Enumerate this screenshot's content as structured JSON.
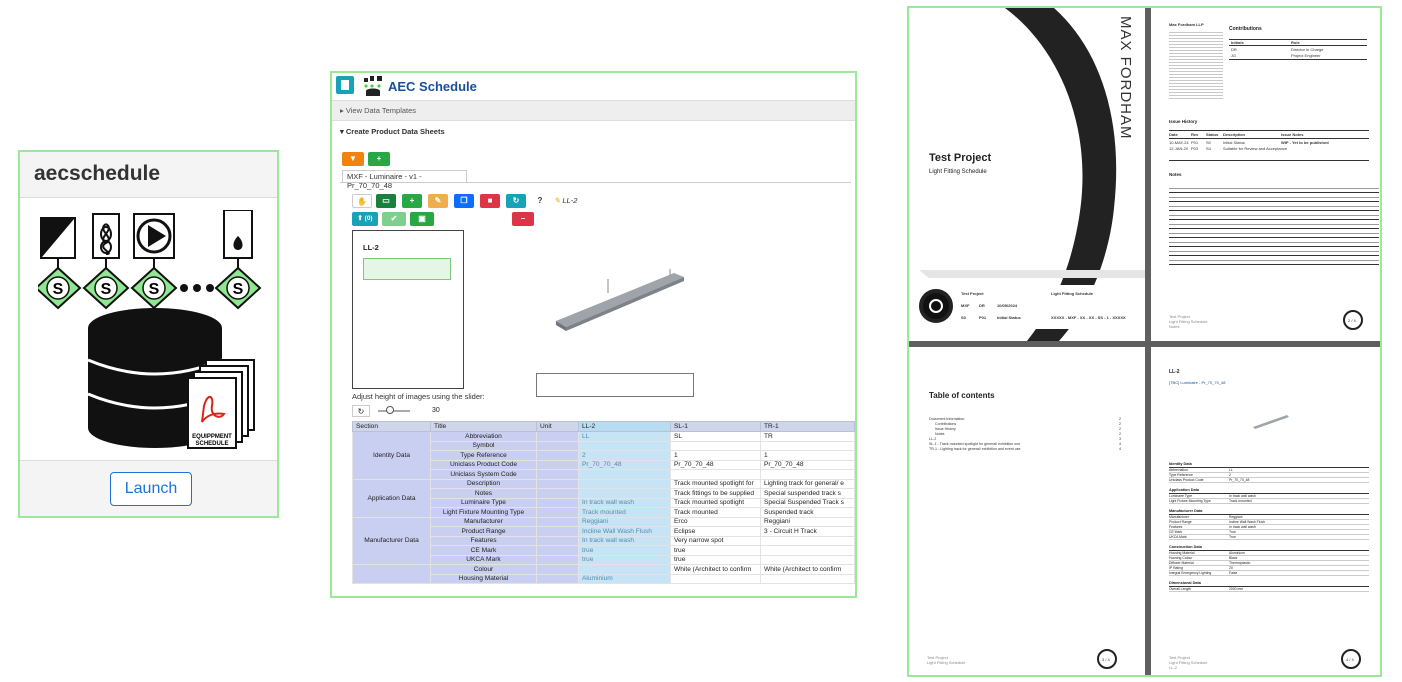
{
  "card_aec": {
    "title": "aecschedule",
    "launch_label": "Launch",
    "logo_letter": "S",
    "logo_badge_line1": "EQUIPPMENT",
    "logo_badge_line2": "SCHEDULE"
  },
  "app": {
    "title": "AEC Schedule",
    "view_templates": "View Data Templates",
    "create_sheets": "Create Product Data Sheets",
    "tab_label": "MXF - Luminaire - v1 - Pr_70_70_48",
    "toolbar_help": "?",
    "current_item": "LL-2",
    "upload_label": "(0)",
    "pds_label": "LL-2",
    "slider_hint": "Adjust height of images using the slider:",
    "slider_value": "30",
    "table": {
      "headers": [
        "Section",
        "Title",
        "Unit",
        "LL-2",
        "SL-1",
        "TR-1"
      ],
      "groups": [
        {
          "section": "Identity Data",
          "rows": [
            {
              "title": "Abbreviation",
              "unit": "",
              "ll2": "LL",
              "sl1": "SL",
              "tr1": "TR"
            },
            {
              "title": "Symbol",
              "unit": "",
              "ll2": "",
              "sl1": "",
              "tr1": ""
            },
            {
              "title": "Type Reference",
              "unit": "",
              "ll2": "2",
              "sl1": "1",
              "tr1": "1"
            },
            {
              "title": "Uniclass Product Code",
              "unit": "",
              "ll2": "Pr_70_70_48",
              "sl1": "Pr_70_70_48",
              "tr1": "Pr_70_70_48"
            },
            {
              "title": "Uniclass System Code",
              "unit": "",
              "ll2": "",
              "sl1": "",
              "tr1": ""
            }
          ]
        },
        {
          "section": "Application Data",
          "rows": [
            {
              "title": "Description",
              "unit": "",
              "ll2": "",
              "sl1": "Track mounted spotlight for",
              "tr1": "Lighting track for general/ e"
            },
            {
              "title": "Notes",
              "unit": "",
              "ll2": "",
              "sl1": "Track fittings to be supplied",
              "tr1": "Special suspended track s"
            },
            {
              "title": "Luminaire Type",
              "unit": "",
              "ll2": "In track wall wash",
              "sl1": "Track mounted spotlight",
              "tr1": "Special Suspended Track s"
            },
            {
              "title": "Light Fixture Mounting Type",
              "unit": "",
              "ll2": "Track mounted",
              "sl1": "Track mounted",
              "tr1": "Suspended track"
            }
          ]
        },
        {
          "section": "Manufacturer Data",
          "rows": [
            {
              "title": "Manufacturer",
              "unit": "",
              "ll2": "Reggiani",
              "sl1": "Erco",
              "tr1": "Reggiani"
            },
            {
              "title": "Product Range",
              "unit": "",
              "ll2": "Incline Wall Wash Flush",
              "sl1": "Eclipse",
              "tr1": "3 - Circuit H Track"
            },
            {
              "title": "Features",
              "unit": "",
              "ll2": "In track wall wash",
              "sl1": "Very narrow spot",
              "tr1": ""
            },
            {
              "title": "CE Mark",
              "unit": "",
              "ll2": "true",
              "sl1": "true",
              "tr1": ""
            },
            {
              "title": "UKCA Mark",
              "unit": "",
              "ll2": "true",
              "sl1": "true",
              "tr1": ""
            }
          ]
        },
        {
          "section": "",
          "rows": [
            {
              "title": "Colour",
              "unit": "",
              "ll2": "",
              "sl1": "White (Architect to confirm",
              "tr1": "White (Architect to confirm"
            },
            {
              "title": "Housing Material",
              "unit": "",
              "ll2": "Aluminium",
              "sl1": "",
              "tr1": ""
            }
          ]
        }
      ]
    }
  },
  "pdf": {
    "brand": "MAX FORDHAM",
    "project": "Test Project",
    "subtitle": "Light Fitting Schedule",
    "cover_meta": [
      "Test Project",
      "Light Fitting Schedule",
      "MXF",
      "DR",
      "10/05/2024",
      "S0",
      "P01",
      "Initial Status",
      "XXXXX - MXF - XX - XX - SS - 1 - XXXXX"
    ],
    "p2_company": "Max Fordham LLP",
    "p2_contrib_title": "Contributions",
    "p2_contrib_headers": [
      "Initials",
      "Role"
    ],
    "p2_contrib_rows": [
      [
        "DR",
        "Director in Charge"
      ],
      [
        "JG",
        "Project Engineer"
      ]
    ],
    "p2_issue_title": "Issue History",
    "p2_issue_headers": [
      "Date",
      "Rev",
      "Status",
      "Description",
      "Issue Notes"
    ],
    "p2_issue_rows": [
      [
        "10-MAY-24",
        "P01",
        "S0",
        "Initial Status",
        "WIP - Yet to be published"
      ],
      [
        "12-JAN-20",
        "P03",
        "S4",
        "Suitable for Review and Acceptance",
        ""
      ]
    ],
    "p2_notes_title": "Notes",
    "p2_footer": "Test Project",
    "p2_footer2": "Light Fitting Schedule",
    "p2_footer3": "Notes",
    "p2_page": "2 / 4",
    "toc_title": "Table of contents",
    "toc_items": [
      "Document Information",
      "Contributions",
      "Issue History",
      "Notes",
      "LL-2",
      "SL-1 - Track mounted spotlight for general/ exhibition use",
      "TR-1 - Lighting track for general/ exhibition and event use"
    ],
    "toc_pages": [
      "2",
      "2",
      "2",
      "2",
      "3",
      "4",
      "4"
    ],
    "p3_page": "3 / 4",
    "p4_title": "LL-2",
    "p4_sub": "[TBC] Luminaire - Pr_70_70_48",
    "p4_sections": [
      {
        "name": "Identity Data",
        "rows": [
          [
            "Abbreviation",
            "LL"
          ],
          [
            "Type Reference",
            "2"
          ],
          [
            "Uniclass Product Code",
            "Pr_70_70_48"
          ]
        ]
      },
      {
        "name": "Application Data",
        "rows": [
          [
            "Luminaire Type",
            "In track wall wash"
          ],
          [
            "Light Fixture Mounting Type",
            "Track mounted"
          ]
        ]
      },
      {
        "name": "Manufacturer Data",
        "rows": [
          [
            "Manufacturer",
            "Reggiani"
          ],
          [
            "Product Range",
            "Incline Wall Wash Flush"
          ],
          [
            "Features",
            "In track wall wash"
          ],
          [
            "CE Mark",
            "True"
          ],
          [
            "UKCA Mark",
            "True"
          ]
        ]
      },
      {
        "name": "Construction Data",
        "rows": [
          [
            "Housing Material",
            "Aluminium"
          ],
          [
            "Housing Colour",
            "Black"
          ],
          [
            "Diffuser Material",
            "Thermoplastic"
          ],
          [
            "IP Rating",
            "20"
          ],
          [
            "Integral Emergency Lighting",
            "False"
          ]
        ]
      },
      {
        "name": "Dimensional Data",
        "rows": [
          [
            "Overall Length",
            "2000 mm"
          ]
        ]
      }
    ],
    "p4_page": "4 / 4",
    "footer_proj": "Test Project",
    "footer_sched": "Light Fitting Schedule",
    "footer_ll2": "LL-2"
  },
  "colors": {
    "card_border": "#9be89b",
    "launch_blue": "#1d72d8",
    "app_title_blue": "#1a4fa0",
    "btn_orange": "#f0820f",
    "btn_green": "#28a745",
    "btn_red": "#dc3545",
    "btn_blue": "#0d6efd",
    "btn_teal": "#17a2b8",
    "btn_yellow": "#f0ad4e",
    "diamond_green": "#8fe88f"
  }
}
